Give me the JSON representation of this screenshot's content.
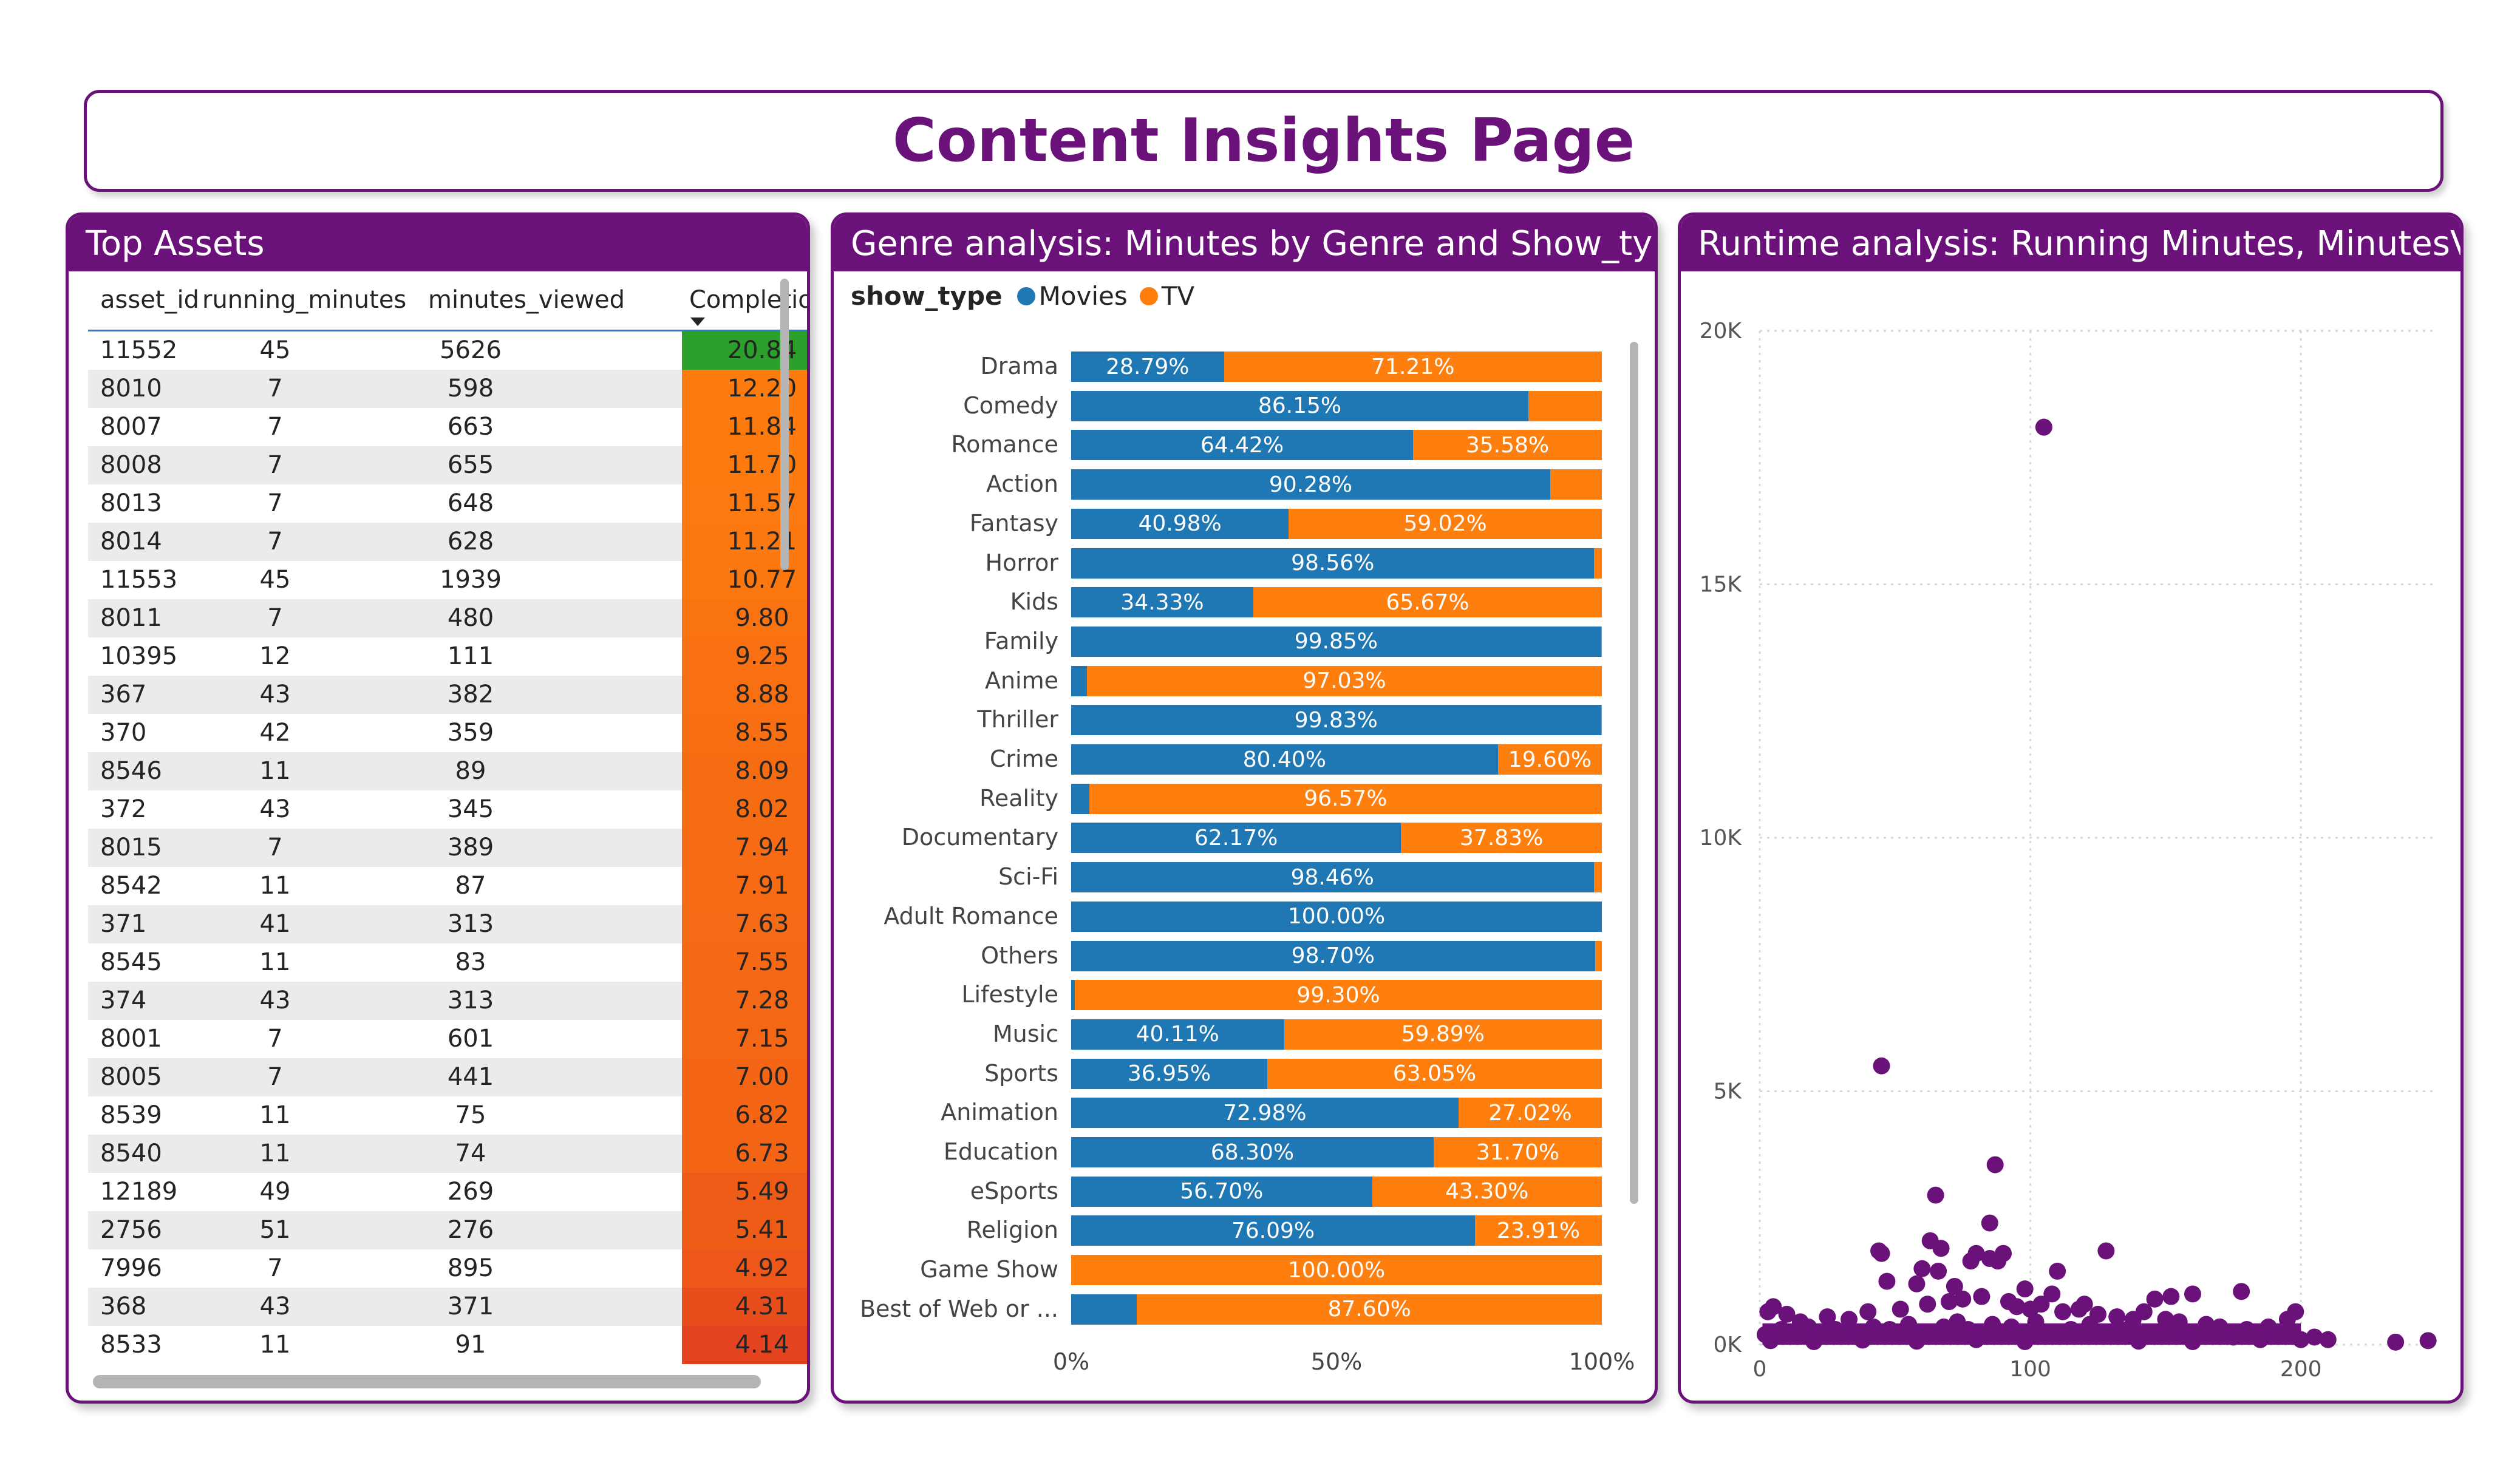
{
  "page_title": "Content Insights Page",
  "top_assets": {
    "title": "Top Assets",
    "columns": [
      "asset_id",
      "running_minutes",
      "minutes_viewed",
      "Completion %"
    ],
    "rows": [
      [
        "11552",
        "45",
        "5626",
        "20.84"
      ],
      [
        "8010",
        "7",
        "598",
        "12.20"
      ],
      [
        "8007",
        "7",
        "663",
        "11.84"
      ],
      [
        "8008",
        "7",
        "655",
        "11.70"
      ],
      [
        "8013",
        "7",
        "648",
        "11.57"
      ],
      [
        "8014",
        "7",
        "628",
        "11.21"
      ],
      [
        "11553",
        "45",
        "1939",
        "10.77"
      ],
      [
        "8011",
        "7",
        "480",
        "9.80"
      ],
      [
        "10395",
        "12",
        "111",
        "9.25"
      ],
      [
        "367",
        "43",
        "382",
        "8.88"
      ],
      [
        "370",
        "42",
        "359",
        "8.55"
      ],
      [
        "8546",
        "11",
        "89",
        "8.09"
      ],
      [
        "372",
        "43",
        "345",
        "8.02"
      ],
      [
        "8015",
        "7",
        "389",
        "7.94"
      ],
      [
        "8542",
        "11",
        "87",
        "7.91"
      ],
      [
        "371",
        "41",
        "313",
        "7.63"
      ],
      [
        "8545",
        "11",
        "83",
        "7.55"
      ],
      [
        "374",
        "43",
        "313",
        "7.28"
      ],
      [
        "8001",
        "7",
        "601",
        "7.15"
      ],
      [
        "8005",
        "7",
        "441",
        "7.00"
      ],
      [
        "8539",
        "11",
        "75",
        "6.82"
      ],
      [
        "8540",
        "11",
        "74",
        "6.73"
      ],
      [
        "12189",
        "49",
        "269",
        "5.49"
      ],
      [
        "2756",
        "51",
        "276",
        "5.41"
      ],
      [
        "7996",
        "7",
        "895",
        "4.92"
      ],
      [
        "368",
        "43",
        "371",
        "4.31"
      ],
      [
        "8533",
        "11",
        "91",
        "4.14"
      ]
    ]
  },
  "genre_panel": {
    "title": "Genre analysis: Minutes by Genre and Show_type",
    "legend_title": "show_type"
  },
  "runtime_panel": {
    "title": "Runtime analysis: Running Minutes, MinutesViewed"
  },
  "colors": {
    "brand": "#6b117a",
    "movies": "#1f77b4",
    "tv": "#ff7f0e",
    "scatter": "#6b117a",
    "completion_high": "#2ca02c",
    "completion_mid": "#ff7f0e",
    "completion_low": "#e4431f"
  },
  "chart_data": [
    {
      "type": "bar",
      "orientation": "horizontal",
      "stacked": "100%",
      "title": "Genre analysis: Minutes by Genre and Show_type",
      "legend_title": "show_type",
      "legend_position": "top-left",
      "categories": [
        "Drama",
        "Comedy",
        "Romance",
        "Action",
        "Fantasy",
        "Horror",
        "Kids",
        "Family",
        "Anime",
        "Thriller",
        "Crime",
        "Reality",
        "Documentary",
        "Sci-Fi",
        "Adult Romance",
        "Others",
        "Lifestyle",
        "Music",
        "Sports",
        "Animation",
        "Education",
        "eSports",
        "Religion",
        "Game Show",
        "Best of Web or ..."
      ],
      "series": [
        {
          "name": "Movies",
          "values": [
            28.79,
            86.15,
            64.42,
            90.28,
            40.98,
            98.56,
            34.33,
            99.85,
            2.97,
            99.83,
            80.4,
            3.43,
            62.17,
            98.46,
            100.0,
            98.7,
            0.7,
            40.11,
            36.95,
            72.98,
            68.3,
            56.7,
            76.09,
            0.0,
            12.4
          ],
          "labels": [
            "28.79%",
            "86.15%",
            "64.42%",
            "90.28%",
            "40.98%",
            "98.56%",
            "34.33%",
            "99.85%",
            "",
            "99.83%",
            "80.40%",
            "",
            "62.17%",
            "98.46%",
            "100.00%",
            "98.70%",
            "",
            "40.11%",
            "36.95%",
            "72.98%",
            "68.30%",
            "56.70%",
            "76.09%",
            "",
            ""
          ]
        },
        {
          "name": "TV",
          "values": [
            71.21,
            13.85,
            35.58,
            9.72,
            59.02,
            1.44,
            65.67,
            0.15,
            97.03,
            0.17,
            19.6,
            96.57,
            37.83,
            1.54,
            0.0,
            1.3,
            99.3,
            59.89,
            63.05,
            27.02,
            31.7,
            43.3,
            23.91,
            100.0,
            87.6
          ],
          "labels": [
            "71.21%",
            "",
            "35.58%",
            "",
            "59.02%",
            "",
            "65.67%",
            "",
            "97.03%",
            "",
            "19.60%",
            "96.57%",
            "37.83%",
            "",
            "",
            "",
            "99.30%",
            "59.89%",
            "63.05%",
            "27.02%",
            "31.70%",
            "43.30%",
            "23.91%",
            "100.00%",
            "87.60%"
          ]
        }
      ],
      "xlim": [
        0,
        100
      ],
      "x_ticks": [
        "0%",
        "50%",
        "100%"
      ]
    },
    {
      "type": "scatter",
      "title": "Runtime analysis: Running Minutes, MinutesViewed",
      "xlim": [
        0,
        250
      ],
      "ylim": [
        0,
        20000
      ],
      "x_ticks": [
        "0",
        "100",
        "200"
      ],
      "y_ticks": [
        "0K",
        "5K",
        "10K",
        "15K",
        "20K"
      ],
      "grid": true,
      "points": [
        [
          105,
          18100
        ],
        [
          45,
          5500
        ],
        [
          87,
          3550
        ],
        [
          65,
          2950
        ],
        [
          85,
          2400
        ],
        [
          128,
          1850
        ],
        [
          45,
          1800
        ],
        [
          44,
          1850
        ],
        [
          63,
          2050
        ],
        [
          67,
          1900
        ],
        [
          80,
          1800
        ],
        [
          85,
          1700
        ],
        [
          90,
          1800
        ],
        [
          88,
          1650
        ],
        [
          110,
          1450
        ],
        [
          66,
          1450
        ],
        [
          78,
          1650
        ],
        [
          60,
          1500
        ],
        [
          47,
          1250
        ],
        [
          58,
          1200
        ],
        [
          160,
          1000
        ],
        [
          178,
          1050
        ],
        [
          146,
          900
        ],
        [
          152,
          950
        ],
        [
          120,
          800
        ],
        [
          108,
          1000
        ],
        [
          98,
          1100
        ],
        [
          72,
          1150
        ],
        [
          5,
          750
        ],
        [
          3,
          650
        ],
        [
          10,
          600
        ],
        [
          25,
          550
        ],
        [
          33,
          500
        ],
        [
          15,
          450
        ],
        [
          40,
          650
        ],
        [
          52,
          700
        ],
        [
          62,
          800
        ],
        [
          70,
          850
        ],
        [
          75,
          900
        ],
        [
          82,
          950
        ],
        [
          92,
          850
        ],
        [
          95,
          750
        ],
        [
          100,
          700
        ],
        [
          104,
          800
        ],
        [
          112,
          650
        ],
        [
          118,
          700
        ],
        [
          125,
          600
        ],
        [
          132,
          550
        ],
        [
          138,
          500
        ],
        [
          142,
          650
        ],
        [
          150,
          500
        ],
        [
          155,
          450
        ],
        [
          165,
          400
        ],
        [
          170,
          350
        ],
        [
          180,
          300
        ],
        [
          188,
          350
        ],
        [
          195,
          500
        ],
        [
          198,
          650
        ],
        [
          205,
          150
        ],
        [
          210,
          100
        ],
        [
          235,
          50
        ],
        [
          247,
          80
        ],
        [
          2,
          200
        ],
        [
          8,
          300
        ],
        [
          12,
          250
        ],
        [
          18,
          350
        ],
        [
          22,
          200
        ],
        [
          28,
          300
        ],
        [
          35,
          250
        ],
        [
          42,
          350
        ],
        [
          48,
          300
        ],
        [
          55,
          400
        ],
        [
          68,
          350
        ],
        [
          73,
          450
        ],
        [
          77,
          300
        ],
        [
          86,
          400
        ],
        [
          93,
          350
        ],
        [
          102,
          450
        ],
        [
          115,
          300
        ],
        [
          122,
          400
        ],
        [
          130,
          250
        ],
        [
          136,
          300
        ],
        [
          145,
          200
        ],
        [
          158,
          250
        ],
        [
          168,
          200
        ],
        [
          175,
          150
        ],
        [
          185,
          100
        ],
        [
          192,
          200
        ],
        [
          200,
          100
        ],
        [
          4,
          80
        ],
        [
          20,
          60
        ],
        [
          38,
          90
        ],
        [
          58,
          70
        ],
        [
          80,
          100
        ],
        [
          98,
          60
        ],
        [
          140,
          70
        ],
        [
          160,
          60
        ]
      ]
    }
  ]
}
